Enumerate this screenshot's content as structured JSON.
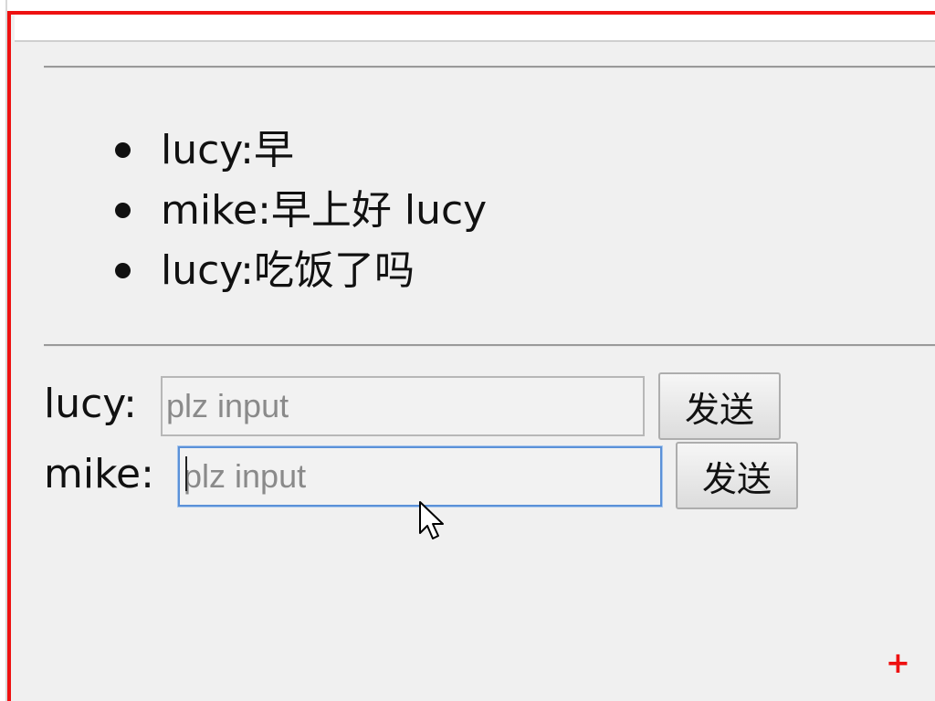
{
  "messages": [
    {
      "text": "lucy:早"
    },
    {
      "text": "mike:早上好 lucy"
    },
    {
      "text": "lucy:吃饭了吗"
    }
  ],
  "lucy": {
    "label": "lucy:",
    "placeholder": "plz input",
    "value": "",
    "send_label": "发送"
  },
  "mike": {
    "label": "mike:",
    "placeholder": "plz input",
    "value": "",
    "send_label": "发送"
  },
  "icons": {
    "cursor": "mouse-pointer-icon",
    "corner": "plus-icon"
  },
  "colors": {
    "frame_border": "#ee1111",
    "focus_border": "#5b91d8",
    "background": "#f0f0f0"
  }
}
